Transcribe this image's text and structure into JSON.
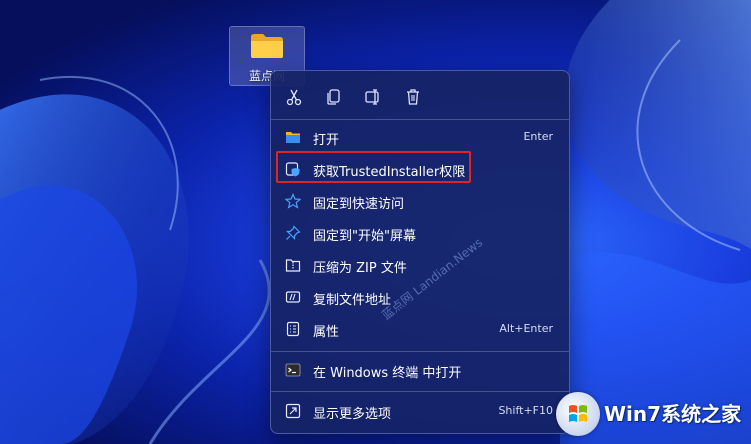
{
  "desktop": {
    "folder_label": "蓝点网"
  },
  "toolbar": {
    "cut_icon": "scissors-icon",
    "copy_icon": "copy-icon",
    "rename_icon": "rename-icon",
    "delete_icon": "trash-icon"
  },
  "menu": {
    "items": [
      {
        "label": "打开",
        "shortcut": "Enter",
        "icon": "folder-icon"
      },
      {
        "label": "获取TrustedInstaller权限",
        "shortcut": "",
        "icon": "shield-icon"
      },
      {
        "label": "固定到快速访问",
        "shortcut": "",
        "icon": "star-icon"
      },
      {
        "label": "固定到\"开始\"屏幕",
        "shortcut": "",
        "icon": "pin-icon"
      },
      {
        "label": "压缩为 ZIP 文件",
        "shortcut": "",
        "icon": "zip-icon"
      },
      {
        "label": "复制文件地址",
        "shortcut": "",
        "icon": "path-icon"
      },
      {
        "label": "属性",
        "shortcut": "Alt+Enter",
        "icon": "properties-icon"
      },
      {
        "label": "在 Windows 终端 中打开",
        "shortcut": "",
        "icon": "terminal-icon"
      },
      {
        "label": "显示更多选项",
        "shortcut": "Shift+F10",
        "icon": "more-options-icon"
      }
    ]
  },
  "watermark": "蓝点网 Landian.News",
  "logo": {
    "text": "Win7系统之家"
  },
  "colors": {
    "accent": "#e02424",
    "menu_bg": "#16236a"
  }
}
